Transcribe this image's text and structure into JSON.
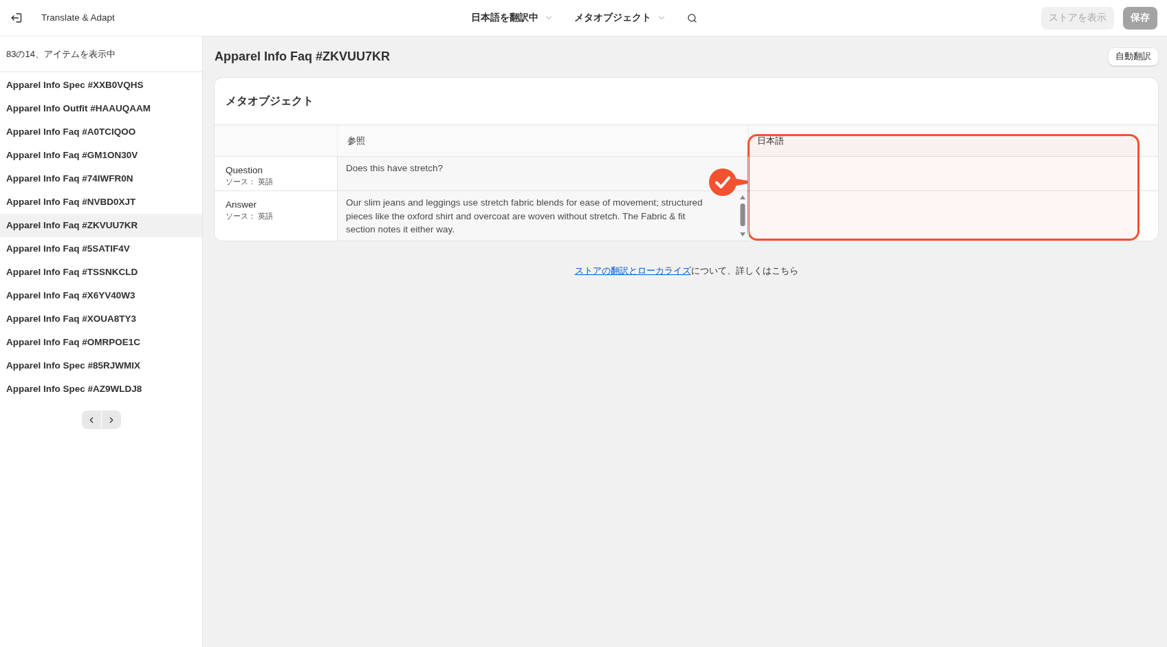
{
  "top_bar": {
    "app_title": "Translate & Adapt",
    "menus": [
      {
        "label": "日本語を翻訳中"
      },
      {
        "label": "メタオブジェクト"
      }
    ],
    "buttons": [
      {
        "label": "ストアを表示",
        "kind": "secondary",
        "disabled": true
      },
      {
        "label": "保存",
        "kind": "primary",
        "disabled": true
      }
    ]
  },
  "sidebar": {
    "count_label": "83の14、アイテムを表示中",
    "items": [
      {
        "label": "Apparel Info Spec #XXB0VQHS",
        "selected": false
      },
      {
        "label": "Apparel Info Outfit #HAAUQAAM",
        "selected": false
      },
      {
        "label": "Apparel Info Faq #A0TCIQOO",
        "selected": false
      },
      {
        "label": "Apparel Info Faq #GM1ON30V",
        "selected": false
      },
      {
        "label": "Apparel Info Faq #74IWFR0N",
        "selected": false
      },
      {
        "label": "Apparel Info Faq #NVBD0XJT",
        "selected": false
      },
      {
        "label": "Apparel Info Faq #ZKVUU7KR",
        "selected": true
      },
      {
        "label": "Apparel Info Faq #5SATIF4V",
        "selected": false
      },
      {
        "label": "Apparel Info Faq #TSSNKCLD",
        "selected": false
      },
      {
        "label": "Apparel Info Faq #X6YV40W3",
        "selected": false
      },
      {
        "label": "Apparel Info Faq #XOUA8TY3",
        "selected": false
      },
      {
        "label": "Apparel Info Faq #OMRPOE1C",
        "selected": false
      },
      {
        "label": "Apparel Info Spec #85RJWMIX",
        "selected": false
      },
      {
        "label": "Apparel Info Spec #AZ9WLDJ8",
        "selected": false
      }
    ]
  },
  "main": {
    "title": "Apparel Info Faq #ZKVUU7KR",
    "auto_translate_button": "自動翻訳",
    "card": {
      "title": "メタオブジェクト",
      "table": {
        "reference_heading": "参照",
        "translation_heading": "日本語",
        "translation_highlighted": true,
        "rows": [
          {
            "field": "Question",
            "source": "ソース： 英語",
            "reference": "Does this have stretch?",
            "scrollable": false
          },
          {
            "field": "Answer",
            "source": "ソース： 英語",
            "reference": "Our slim jeans and leggings use stretch fabric blends for ease of movement; structured pieces like the oxford shirt and overcoat are woven without stretch. The Fabric & fit section notes it either way.",
            "scrollable": true
          }
        ]
      }
    },
    "help": {
      "link": "ストアの翻訳とローカライズ",
      "text": "について、詳しくはこちら"
    }
  }
}
